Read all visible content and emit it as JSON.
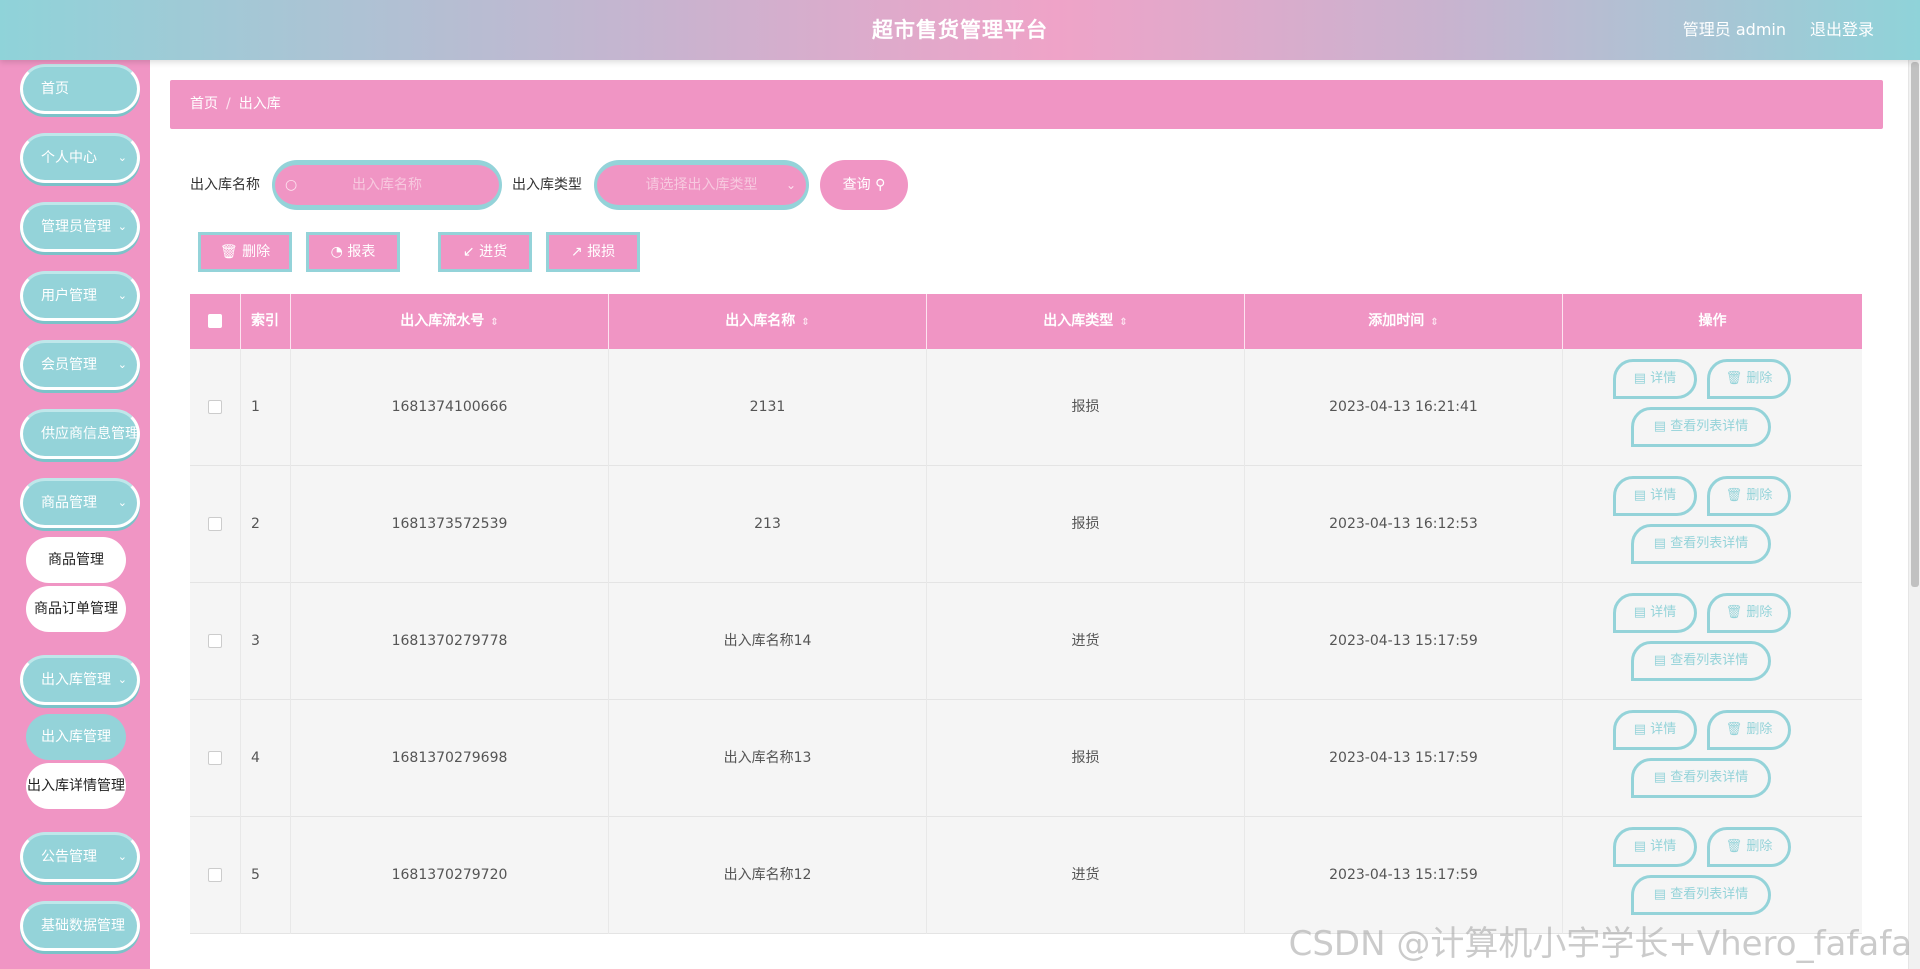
{
  "header": {
    "title": "超市售货管理平台",
    "admin_label": "管理员 admin",
    "logout_label": "退出登录"
  },
  "sidebar": {
    "items": [
      {
        "label": "首页"
      },
      {
        "label": "个人中心"
      },
      {
        "label": "管理员管理"
      },
      {
        "label": "用户管理"
      },
      {
        "label": "会员管理"
      },
      {
        "label": "供应商信息管理"
      },
      {
        "label": "商品管理"
      },
      {
        "label": "出入库管理"
      },
      {
        "label": "公告管理"
      },
      {
        "label": "基础数据管理"
      }
    ],
    "sub_goods": [
      {
        "label": "商品管理"
      },
      {
        "label": "商品订单管理"
      }
    ],
    "sub_stock": [
      {
        "label": "出入库管理"
      },
      {
        "label": "出入库详情管理"
      }
    ],
    "chevron": "chevron-down-icon"
  },
  "breadcrumb": {
    "home": "首页",
    "sep": "/",
    "current": "出入库"
  },
  "search": {
    "name_label": "出入库名称",
    "name_placeholder": "出入库名称",
    "type_label": "出入库类型",
    "type_placeholder": "请选择出入库类型",
    "query_label": "查询"
  },
  "actions": {
    "delete": "删除",
    "report": "报表",
    "stock_in": "进货",
    "damage": "报损"
  },
  "table": {
    "headers": {
      "index": "索引",
      "serial": "出入库流水号",
      "name": "出入库名称",
      "type": "出入库类型",
      "time": "添加时间",
      "ops": "操作"
    },
    "rows": [
      {
        "index": "1",
        "serial": "1681374100666",
        "name": "2131",
        "type": "报损",
        "time": "2023-04-13 16:21:41"
      },
      {
        "index": "2",
        "serial": "1681373572539",
        "name": "213",
        "type": "报损",
        "time": "2023-04-13 16:12:53"
      },
      {
        "index": "3",
        "serial": "1681370279778",
        "name": "出入库名称14",
        "type": "进货",
        "time": "2023-04-13 15:17:59"
      },
      {
        "index": "4",
        "serial": "1681370279698",
        "name": "出入库名称13",
        "type": "报损",
        "time": "2023-04-13 15:17:59"
      },
      {
        "index": "5",
        "serial": "1681370279720",
        "name": "出入库名称12",
        "type": "进货",
        "time": "2023-04-13 15:17:59"
      }
    ],
    "op_labels": {
      "detail": "详情",
      "delete": "删除",
      "list_detail": "查看列表详情"
    }
  },
  "watermark": "CSDN @计算机小宇学长+Vhero_fafafa",
  "colors": {
    "pink": "#f095c4",
    "teal": "#94d3d9"
  }
}
